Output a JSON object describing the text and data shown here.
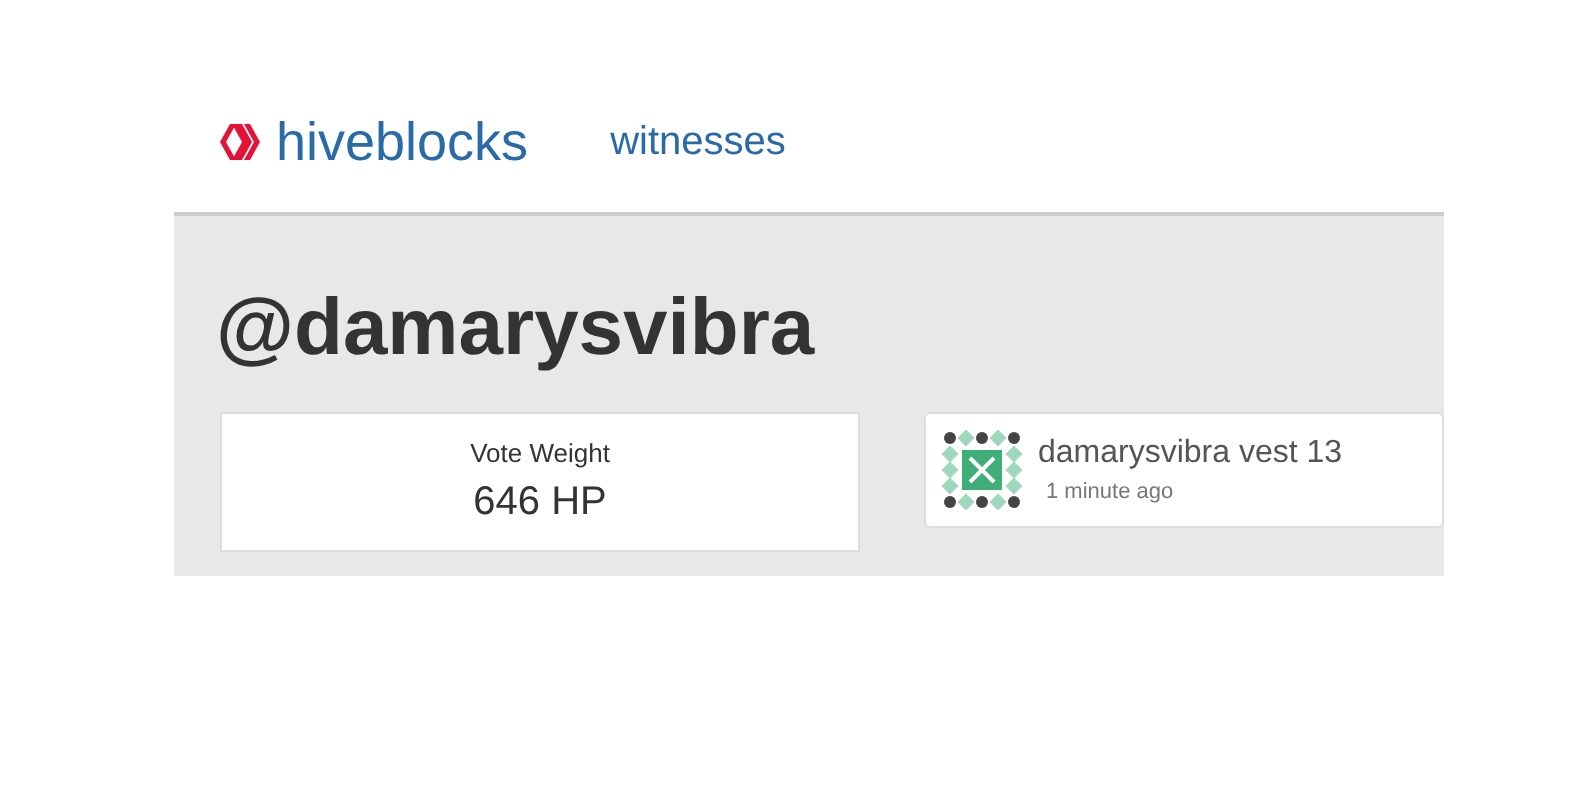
{
  "header": {
    "brand": "hiveblocks",
    "nav": [
      {
        "label": "witnesses"
      }
    ]
  },
  "account": {
    "name": "@damarysvibra"
  },
  "vote_card": {
    "label": "Vote Weight",
    "value": "646 HP"
  },
  "activity": [
    {
      "text": "damarysvibra vest 13",
      "time": "1 minute ago"
    }
  ]
}
